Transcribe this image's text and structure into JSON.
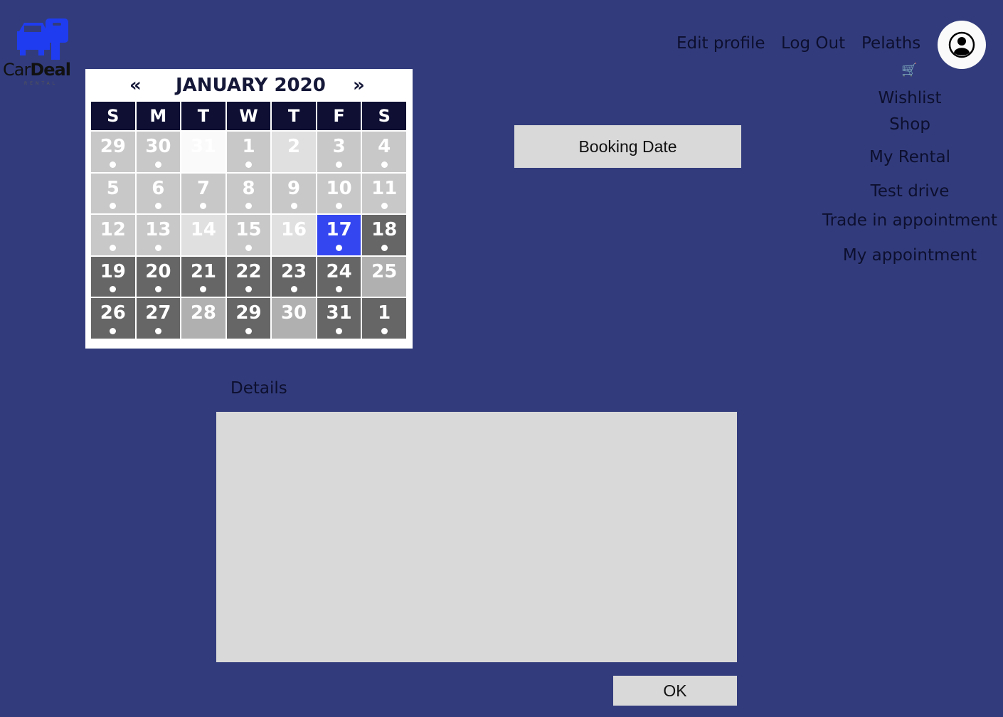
{
  "logo": {
    "brand_a": "Car",
    "brand_b": "Deal",
    "sub": "RENTAL",
    "accent": "#1f3cf0"
  },
  "header": {
    "links": [
      "Edit profile",
      "Log Out",
      "Pelaths"
    ],
    "avatar_icon": "user-circle-icon",
    "cart_icon": "shopping-cart-icon"
  },
  "sidebar": {
    "items": [
      "Wishlist",
      "Shop",
      "My Rental",
      "Test drive",
      "Trade in appointment",
      "My appointment"
    ]
  },
  "calendar": {
    "prev": "«",
    "next": "»",
    "title": "JANUARY 2020",
    "weekdays": [
      "S",
      "M",
      "T",
      "W",
      "T",
      "F",
      "S"
    ],
    "selected": "17",
    "days": [
      {
        "n": "29",
        "s": "gray",
        "dot": true
      },
      {
        "n": "30",
        "s": "gray",
        "dot": true
      },
      {
        "n": "31",
        "s": "white",
        "dot": false
      },
      {
        "n": "1",
        "s": "gray",
        "dot": true
      },
      {
        "n": "2",
        "s": "light",
        "dot": false
      },
      {
        "n": "3",
        "s": "gray",
        "dot": true
      },
      {
        "n": "4",
        "s": "gray",
        "dot": true
      },
      {
        "n": "5",
        "s": "gray",
        "dot": true
      },
      {
        "n": "6",
        "s": "gray",
        "dot": true
      },
      {
        "n": "7",
        "s": "gray",
        "dot": true
      },
      {
        "n": "8",
        "s": "gray",
        "dot": true
      },
      {
        "n": "9",
        "s": "gray",
        "dot": true
      },
      {
        "n": "10",
        "s": "gray",
        "dot": true
      },
      {
        "n": "11",
        "s": "gray",
        "dot": true
      },
      {
        "n": "12",
        "s": "gray",
        "dot": true
      },
      {
        "n": "13",
        "s": "gray",
        "dot": true
      },
      {
        "n": "14",
        "s": "light",
        "dot": false
      },
      {
        "n": "15",
        "s": "gray",
        "dot": true
      },
      {
        "n": "16",
        "s": "light",
        "dot": false
      },
      {
        "n": "17",
        "s": "sel",
        "dot": true
      },
      {
        "n": "18",
        "s": "dark",
        "dot": true
      },
      {
        "n": "19",
        "s": "dark",
        "dot": true
      },
      {
        "n": "20",
        "s": "dark",
        "dot": true
      },
      {
        "n": "21",
        "s": "dark",
        "dot": true
      },
      {
        "n": "22",
        "s": "dark",
        "dot": true
      },
      {
        "n": "23",
        "s": "dark",
        "dot": true
      },
      {
        "n": "24",
        "s": "dark",
        "dot": true
      },
      {
        "n": "25",
        "s": "mid",
        "dot": false
      },
      {
        "n": "26",
        "s": "dark",
        "dot": true
      },
      {
        "n": "27",
        "s": "dark",
        "dot": true
      },
      {
        "n": "28",
        "s": "mid",
        "dot": false
      },
      {
        "n": "29",
        "s": "dark",
        "dot": true
      },
      {
        "n": "30",
        "s": "mid",
        "dot": false
      },
      {
        "n": "31",
        "s": "dark",
        "dot": true
      },
      {
        "n": "1",
        "s": "dark",
        "dot": true
      }
    ]
  },
  "main": {
    "booking_button": "Booking Date",
    "details_label": "Details",
    "details_value": "",
    "ok_button": "OK"
  }
}
